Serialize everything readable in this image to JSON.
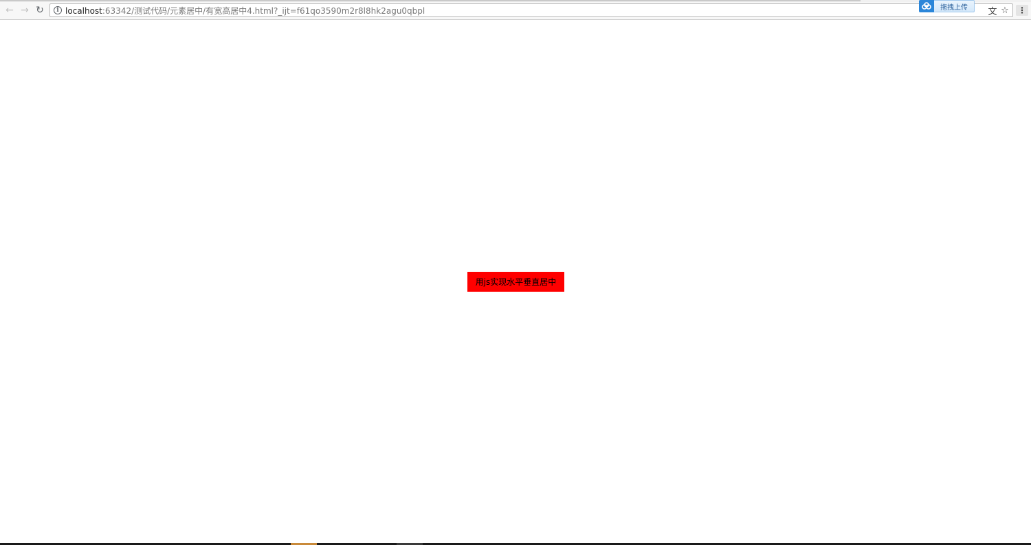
{
  "browser": {
    "url_host": "localhost",
    "url_rest": ":63342/测试代码/元素居中/有宽高居中4.html?_ijt=f61qo3590m2r8l8hk2agu0qbpl",
    "icons": {
      "back": "arrow-left-icon",
      "forward": "arrow-right-icon",
      "reload": "reload-icon",
      "info": "info-icon",
      "translate": "translate-icon",
      "bookmark": "star-icon",
      "menu": "kebab-menu-icon"
    }
  },
  "upload_widget": {
    "button_label": "拖拽上传",
    "logo_color": "#2b86d9"
  },
  "page": {
    "box_text": "用js实现水平垂直居中",
    "box_color": "#ff0000"
  }
}
